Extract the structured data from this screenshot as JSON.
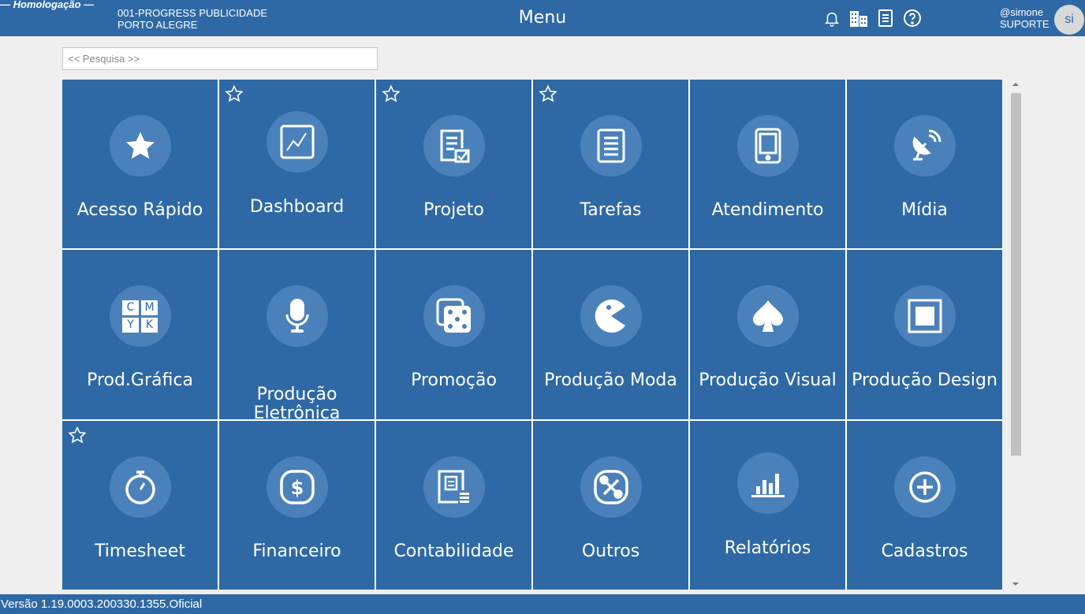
{
  "header": {
    "environment": "— Homologação —",
    "company_line1": "001-PROGRESS PUBLICIDADE",
    "company_line2": "PORTO ALEGRE",
    "title": "Menu",
    "icons": [
      "bell-icon",
      "buildings-icon",
      "document-icon",
      "help-icon"
    ],
    "user_handle": "@simone",
    "user_role": "SUPORTE",
    "avatar_initials": "si"
  },
  "search": {
    "placeholder": "<< Pesquisa >>",
    "value": ""
  },
  "tiles": [
    {
      "label": "Acesso Rápido",
      "icon": "star-icon",
      "favorite": false
    },
    {
      "label": "Dashboard",
      "icon": "chart-icon",
      "favorite": true
    },
    {
      "label": "Projeto",
      "icon": "project-doc-icon",
      "favorite": true
    },
    {
      "label": "Tarefas",
      "icon": "task-list-icon",
      "favorite": true
    },
    {
      "label": "Atendimento",
      "icon": "tablet-icon",
      "favorite": false
    },
    {
      "label": "Mídia",
      "icon": "satellite-dish-icon",
      "favorite": false
    },
    {
      "label": "Prod.Gráfica",
      "icon": "cmyk-icon",
      "favorite": false
    },
    {
      "label": "Produção\nEletrônica",
      "icon": "microphone-icon",
      "favorite": false
    },
    {
      "label": "Promoção",
      "icon": "dice-icon",
      "favorite": false
    },
    {
      "label": "Produção Moda",
      "icon": "pacman-icon",
      "favorite": false
    },
    {
      "label": "Produção Visual",
      "icon": "spade-icon",
      "favorite": false
    },
    {
      "label": "Produção Design",
      "icon": "square-icon",
      "favorite": false
    },
    {
      "label": "Timesheet",
      "icon": "stopwatch-icon",
      "favorite": true
    },
    {
      "label": "Financeiro",
      "icon": "dollar-icon",
      "favorite": false
    },
    {
      "label": "Contabilidade",
      "icon": "accounting-icon",
      "favorite": false
    },
    {
      "label": "Outros",
      "icon": "tools-icon",
      "favorite": false
    },
    {
      "label": "Relatórios",
      "icon": "bar-chart-icon",
      "favorite": false
    },
    {
      "label": "Cadastros",
      "icon": "plus-circle-icon",
      "favorite": false
    }
  ],
  "cmyk_letters": [
    "C",
    "M",
    "Y",
    "K"
  ],
  "footer": {
    "version": "Versão 1.19.0003.200330.1355.Oficial"
  },
  "colors": {
    "primary": "#2e69a5",
    "icon_circle": "#4b81ba",
    "background": "#efefef"
  }
}
